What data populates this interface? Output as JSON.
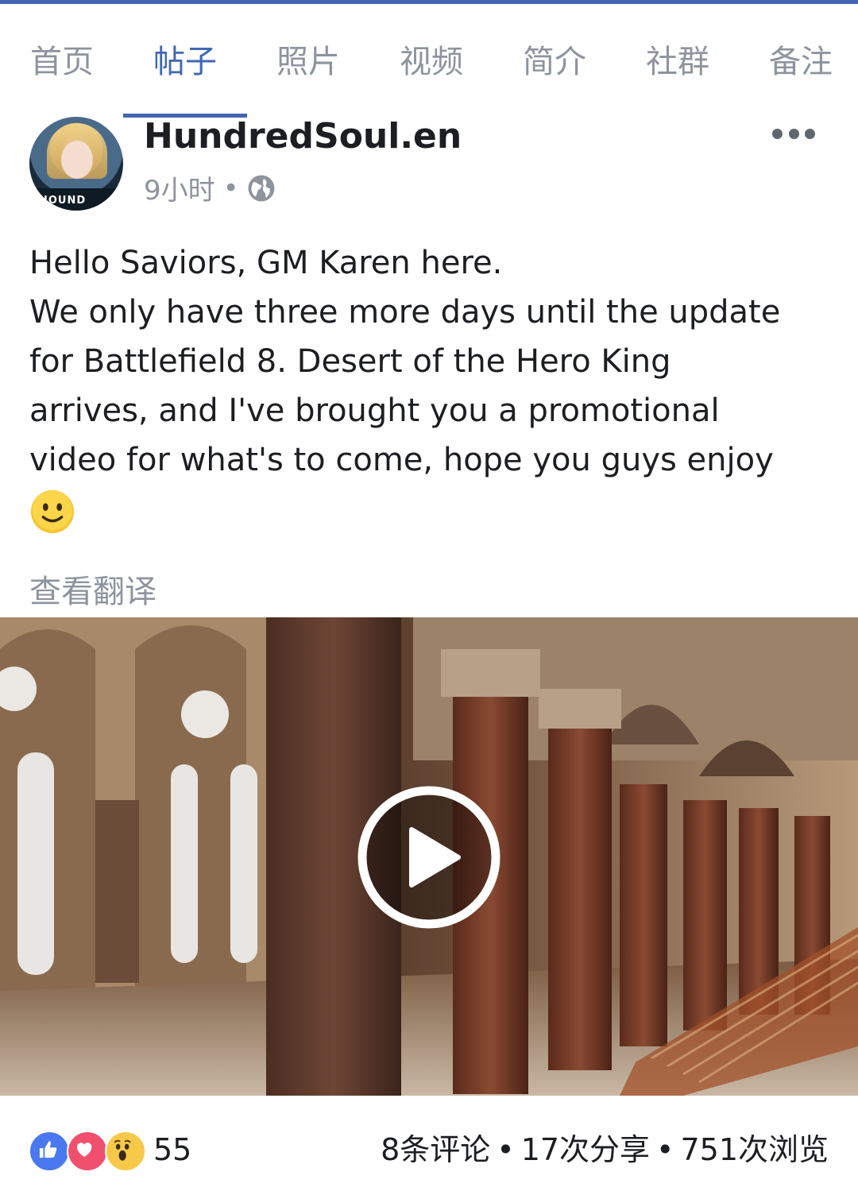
{
  "tabs": [
    {
      "label": "首页",
      "active": false
    },
    {
      "label": "帖子",
      "active": true
    },
    {
      "label": "照片",
      "active": false
    },
    {
      "label": "视频",
      "active": false
    },
    {
      "label": "简介",
      "active": false
    },
    {
      "label": "社群",
      "active": false
    },
    {
      "label": "备注",
      "active": false
    }
  ],
  "post": {
    "page_name": "HundredSoul.en",
    "avatar_text": "HOUND",
    "time": "9小时",
    "meta_separator": "•",
    "privacy_icon": "globe-icon",
    "text_lines": [
      "Hello Saviors, GM Karen here.",
      "We only have three more days until the update",
      "for Battlefield 8. Desert of the Hero King",
      "arrives, and I've brought you a promotional",
      "video for what's to come, hope you guys enjoy"
    ],
    "emoji": "slightly-smiling-face",
    "translate_label": "查看翻译",
    "video_icon": "play-icon"
  },
  "footer": {
    "reactions": [
      "like",
      "love",
      "wow"
    ],
    "reaction_count": "55",
    "comments": "8条评论",
    "shares": "17次分享",
    "views": "751次浏览",
    "separator": "•"
  },
  "colors": {
    "accent": "#4267b2",
    "muted": "#8d949e",
    "text": "#1c1e21"
  }
}
